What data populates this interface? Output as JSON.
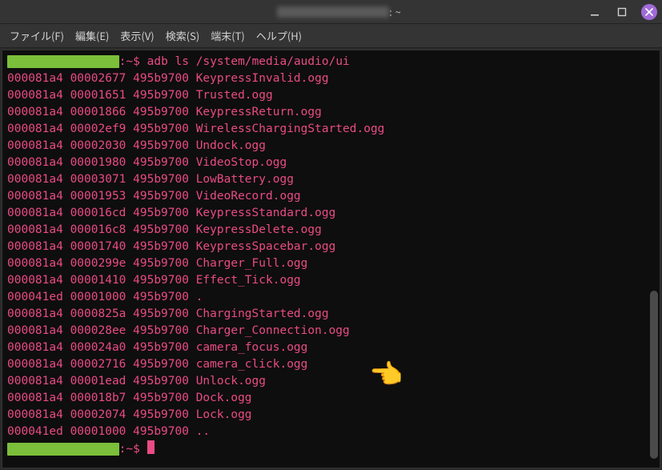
{
  "titlebar": {
    "title_suffix": ": ~"
  },
  "menubar": {
    "items": [
      "ファイル(F)",
      "編集(E)",
      "表示(V)",
      "検索(S)",
      "端末(T)",
      "ヘルプ(H)"
    ]
  },
  "prompt": {
    "sep1": ":",
    "path": "~",
    "dollar": "$"
  },
  "command": "adb ls /system/media/audio/ui",
  "rows": [
    {
      "mode": "000081a4",
      "size": "00002677",
      "time": "495b9700",
      "name": "KeypressInvalid.ogg"
    },
    {
      "mode": "000081a4",
      "size": "00001651",
      "time": "495b9700",
      "name": "Trusted.ogg"
    },
    {
      "mode": "000081a4",
      "size": "00001866",
      "time": "495b9700",
      "name": "KeypressReturn.ogg"
    },
    {
      "mode": "000081a4",
      "size": "00002ef9",
      "time": "495b9700",
      "name": "WirelessChargingStarted.ogg"
    },
    {
      "mode": "000081a4",
      "size": "00002030",
      "time": "495b9700",
      "name": "Undock.ogg"
    },
    {
      "mode": "000081a4",
      "size": "00001980",
      "time": "495b9700",
      "name": "VideoStop.ogg"
    },
    {
      "mode": "000081a4",
      "size": "00003071",
      "time": "495b9700",
      "name": "LowBattery.ogg"
    },
    {
      "mode": "000081a4",
      "size": "00001953",
      "time": "495b9700",
      "name": "VideoRecord.ogg"
    },
    {
      "mode": "000081a4",
      "size": "000016cd",
      "time": "495b9700",
      "name": "KeypressStandard.ogg"
    },
    {
      "mode": "000081a4",
      "size": "000016c8",
      "time": "495b9700",
      "name": "KeypressDelete.ogg"
    },
    {
      "mode": "000081a4",
      "size": "00001740",
      "time": "495b9700",
      "name": "KeypressSpacebar.ogg"
    },
    {
      "mode": "000081a4",
      "size": "0000299e",
      "time": "495b9700",
      "name": "Charger_Full.ogg"
    },
    {
      "mode": "000081a4",
      "size": "00001410",
      "time": "495b9700",
      "name": "Effect_Tick.ogg"
    },
    {
      "mode": "000041ed",
      "size": "00001000",
      "time": "495b9700",
      "name": "."
    },
    {
      "mode": "000081a4",
      "size": "0000825a",
      "time": "495b9700",
      "name": "ChargingStarted.ogg"
    },
    {
      "mode": "000081a4",
      "size": "000028ee",
      "time": "495b9700",
      "name": "Charger_Connection.ogg"
    },
    {
      "mode": "000081a4",
      "size": "000024a0",
      "time": "495b9700",
      "name": "camera_focus.ogg"
    },
    {
      "mode": "000081a4",
      "size": "00002716",
      "time": "495b9700",
      "name": "camera_click.ogg"
    },
    {
      "mode": "000081a4",
      "size": "00001ead",
      "time": "495b9700",
      "name": "Unlock.ogg"
    },
    {
      "mode": "000081a4",
      "size": "000018b7",
      "time": "495b9700",
      "name": "Dock.ogg"
    },
    {
      "mode": "000081a4",
      "size": "00002074",
      "time": "495b9700",
      "name": "Lock.ogg"
    },
    {
      "mode": "000041ed",
      "size": "00001000",
      "time": "495b9700",
      "name": ".."
    }
  ],
  "pointer": "👈",
  "pointer_target_row_index": 17
}
